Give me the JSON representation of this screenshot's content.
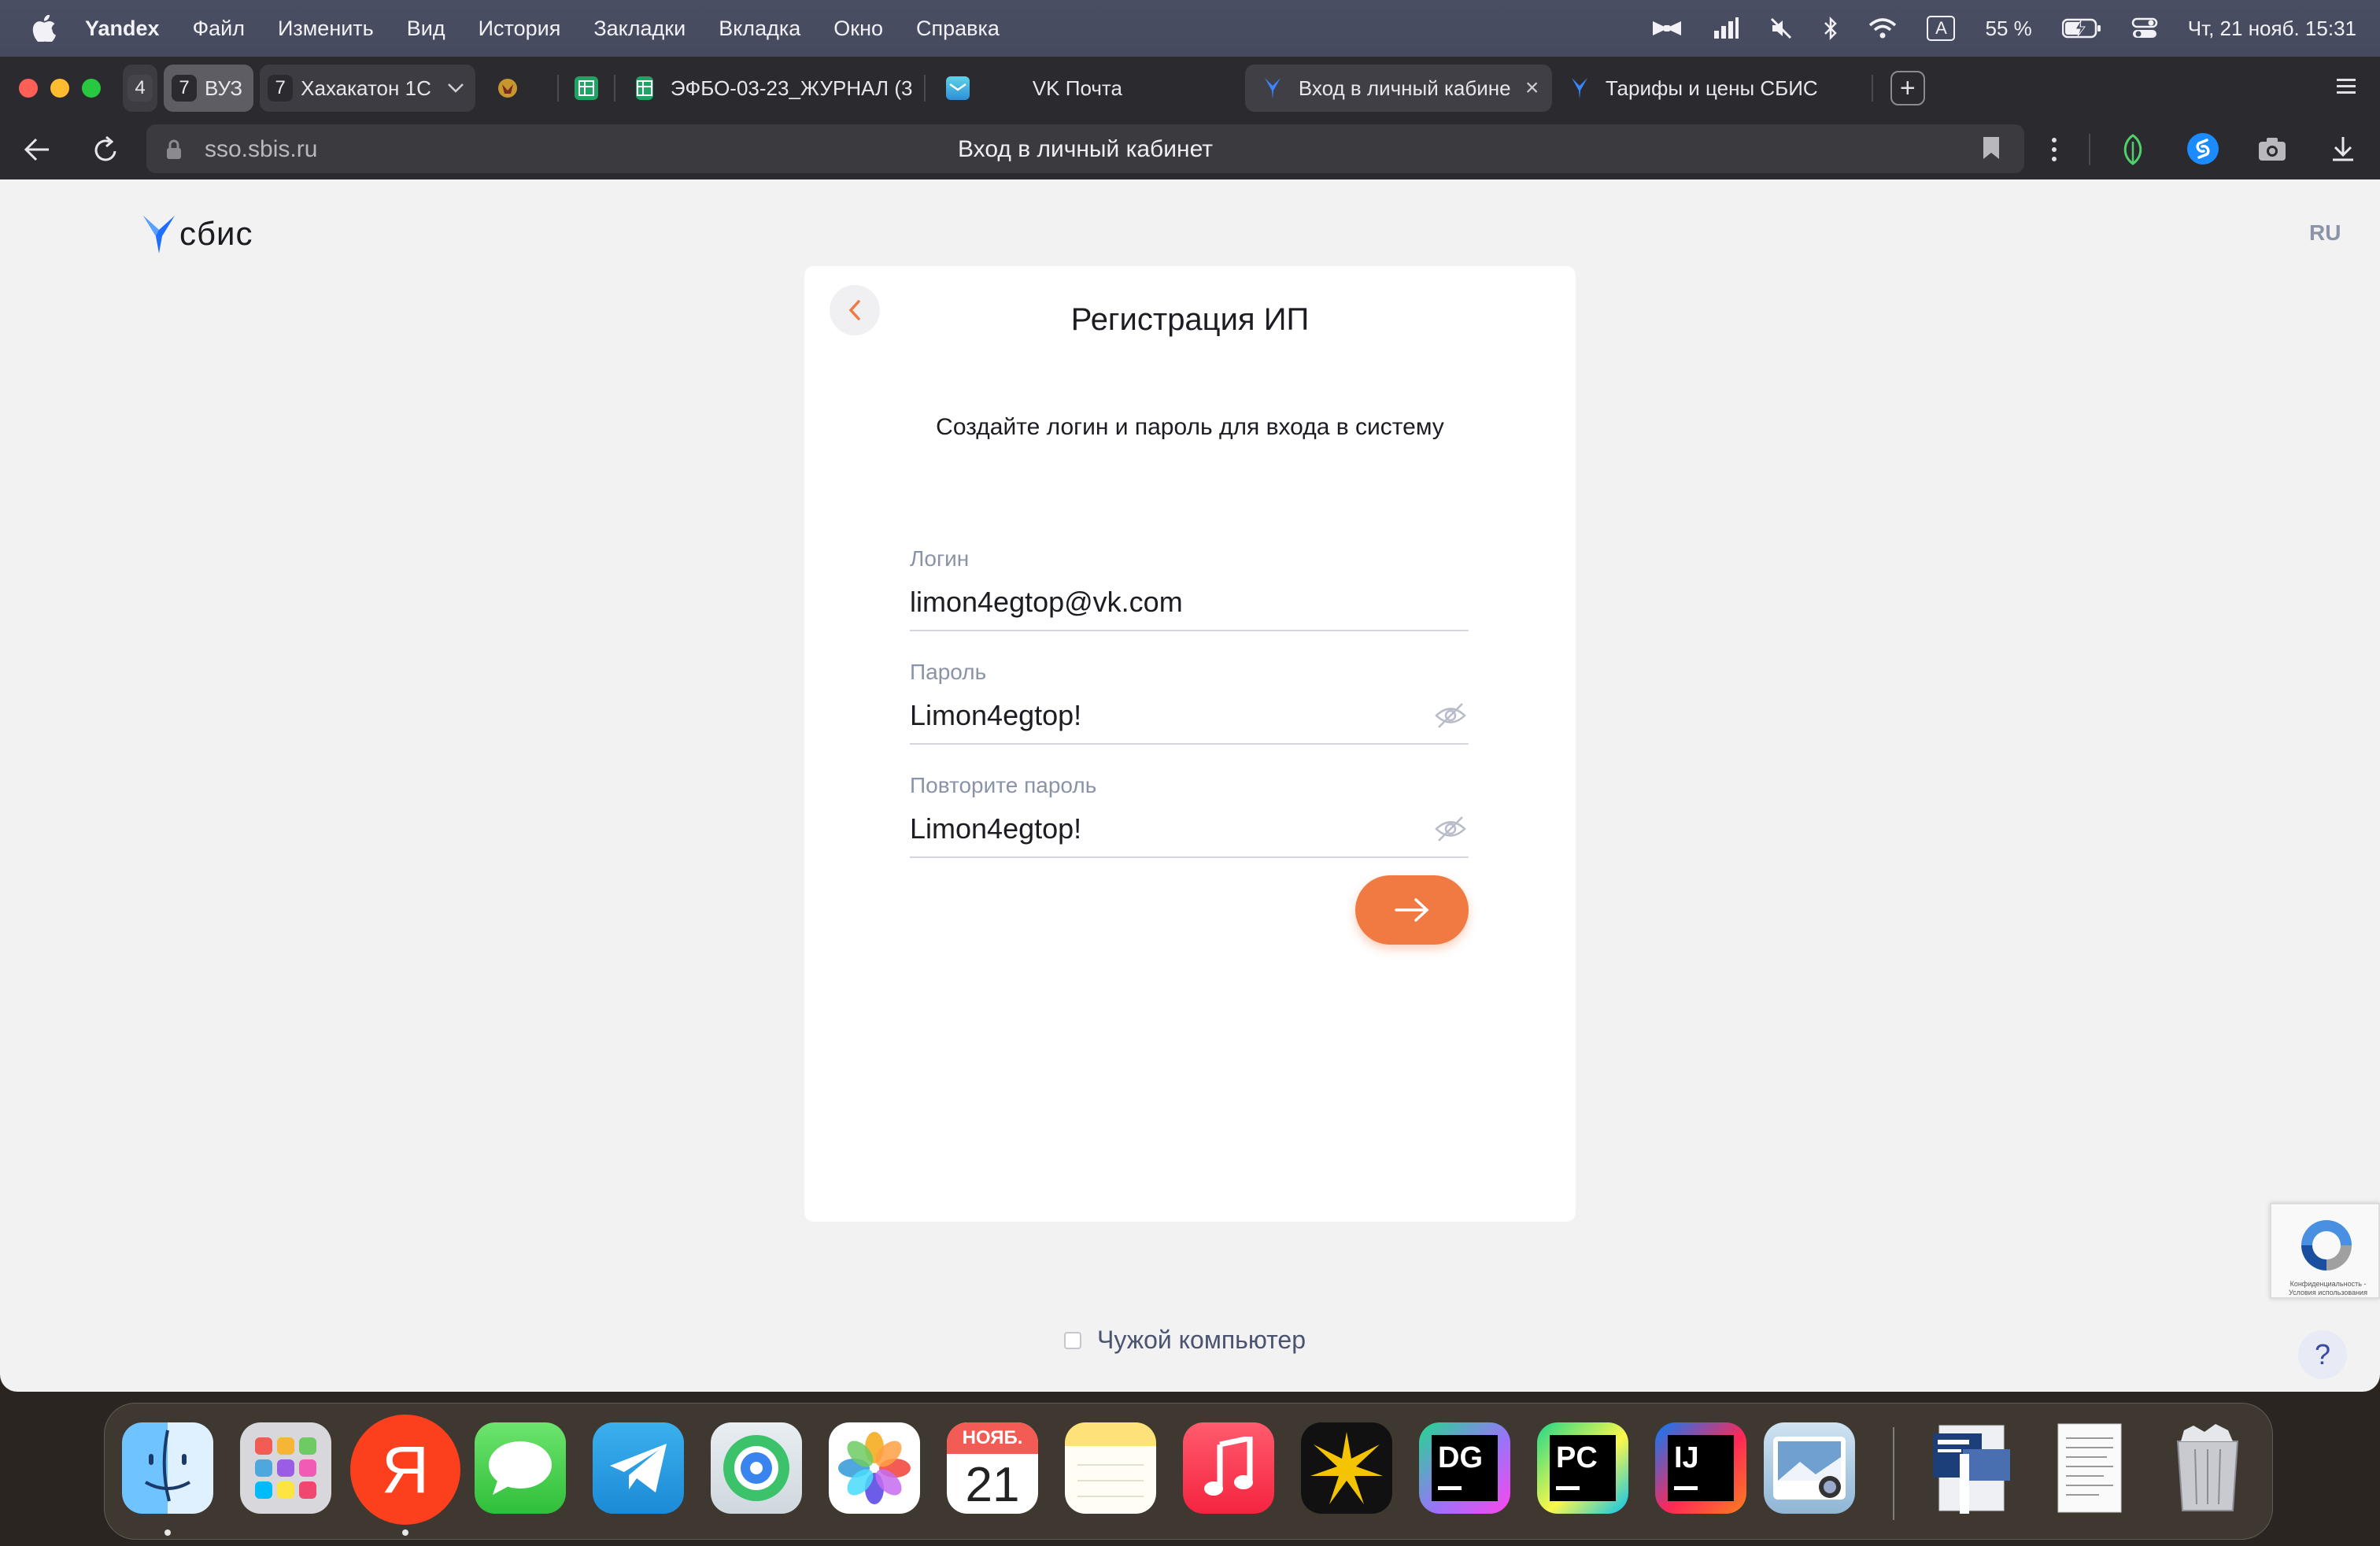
{
  "menubar": {
    "app": "Yandex",
    "items": [
      "Файл",
      "Изменить",
      "Вид",
      "История",
      "Закладки",
      "Вкладка",
      "Окно",
      "Справка"
    ],
    "battery": "55 %",
    "keyboard": "A",
    "datetime": "Чт, 21 нояб.  15:31"
  },
  "tabs": {
    "group1_count": "4",
    "group2_count": "7",
    "group2_label": "ВУЗ",
    "group3_count": "7",
    "group3_label": "Хахакатон 1С",
    "tab_journal": "ЭФБО-03-23_ЖУРНАЛ (3",
    "tab_vkmail": "VK Почта",
    "tab_active": "Вход в личный кабине",
    "tab_tariffs": "Тарифы и цены СБИС"
  },
  "addressbar": {
    "domain": "sso.sbis.ru",
    "page_title": "Вход в личный кабинет"
  },
  "page": {
    "logo_text": "сбис",
    "language": "RU",
    "card": {
      "title": "Регистрация ИП",
      "subtitle": "Создайте логин и пароль для входа в систему",
      "login_label": "Логин",
      "login_value": "limon4egtop@vk.com",
      "password_label": "Пароль",
      "password_value": "Limon4egtop!",
      "repeat_label": "Повторите пароль",
      "repeat_value": "Limon4egtop!"
    },
    "foreign_computer": "Чужой компьютер",
    "recaptcha_text": "Конфиденциальность - Условия использования",
    "help": "?"
  },
  "dock": {
    "calendar_month": "НОЯБ.",
    "calendar_day": "21",
    "yandex_letter": "Я",
    "datagrip": "DG",
    "pycharm": "PC",
    "intellij": "IJ"
  },
  "colors": {
    "accent_orange": "#f07a42",
    "sbis_blue": "#1e6fff",
    "label_gray": "#8a93a7"
  }
}
